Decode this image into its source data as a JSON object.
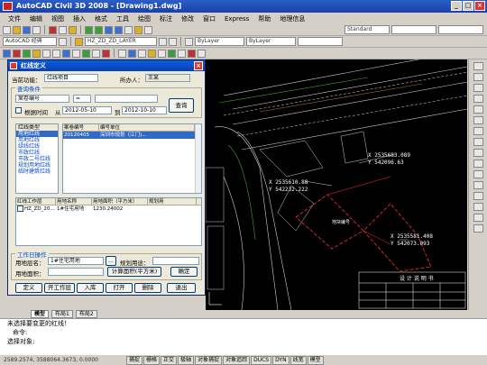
{
  "window": {
    "title": "AutoCAD Civil 3D 2008 - [Drawing1.dwg]",
    "buttons": [
      "_",
      "□",
      "×"
    ]
  },
  "menu": [
    "文件",
    "编辑",
    "视图",
    "插入",
    "格式",
    "工具",
    "绘图",
    "标注",
    "修改",
    "窗口",
    "Express",
    "帮助",
    "地理信息"
  ],
  "toolbars": {
    "row2_combo_style": "Standard",
    "row3_combo_workspace": "AutoCAD 经典",
    "row3_combo_layer": "HZ_ZD_ZD_LAYER",
    "row3_combo_bylayer": "ByLayer",
    "row3_combo_bylayer2": "ByLayer"
  },
  "dialog": {
    "title": "红线定义",
    "close": "×",
    "current_func_label": "当前功能：",
    "current_func_value": "红线项目",
    "owner_label": "所办人：",
    "owner_value": "王某",
    "query_group": "查询条件",
    "query_field": "案卷编号",
    "query_op": "=",
    "date_check_label": "根据时间",
    "date_from_label": "从",
    "date_from": "2012-05-10",
    "date_to_label": "到",
    "date_to": "2012-10-10",
    "query_button": "查询",
    "type_list_header": "红线类型",
    "type_list": [
      "用地红线",
      "用地红线",
      "绿线红线",
      "市政红线",
      "市政二号红线",
      "规划用地红线",
      "临时建筑红线"
    ],
    "case_table_headers": [
      "案卷编号",
      "编号单位"
    ],
    "case_table_rows": [
      [
        "20120405",
        "深圳市规划（江门)..."
      ]
    ],
    "work_table_headers": [
      "红线工作层",
      "用地名称",
      "用地面积（平方米）",
      "规划用"
    ],
    "work_table_rows": [
      [
        "HZ_ZD_20...",
        "1#住宅用地",
        "1230.24002",
        ""
      ]
    ],
    "work_group": "工作日操作",
    "base_layer_label": "用地层名：",
    "base_layer_value": "1#住宅用地",
    "browse": "...",
    "plan_label": "规划用途：",
    "area_label": "用地面积：",
    "area_unit_button": "计算面积(平方米)",
    "confirm_button": "确定",
    "bottom_buttons": [
      "定义",
      "开工作层",
      "入库",
      "打开",
      "删除",
      "退出"
    ]
  },
  "drawing": {
    "coord1": "X 2535683.089",
    "coord1b": "Y 542096.63",
    "coord2": "X 2535610.88",
    "coord2b": "Y 542232.222",
    "coord3": "X 2535581.408",
    "coord3b": "Y 542073.093",
    "parcel_label": "地块编号",
    "titleblock": "设 计 说 明 书"
  },
  "layout_tabs": [
    "模型",
    "布局1",
    "布局2"
  ],
  "command": {
    "line1": "未选择要变更的红线！",
    "line2": "命令:",
    "line3": "选择对象:"
  },
  "status": {
    "coords": "2589.2574, 3588064.3673, 0.0000",
    "toggles": [
      "捕捉",
      "栅格",
      "正交",
      "极轴",
      "对象捕捉",
      "对象追踪",
      "DUCS",
      "DYN",
      "线宽",
      "模型"
    ]
  }
}
